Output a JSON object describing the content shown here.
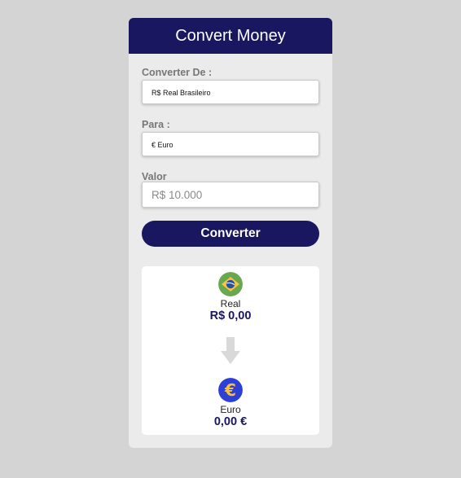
{
  "header": {
    "title": "Convert Money"
  },
  "form": {
    "from_label": "Converter De :",
    "from_selected": "R$ Real Brasileiro",
    "to_label": "Para :",
    "to_selected": "€ Euro",
    "value_label": "Valor",
    "value_placeholder": "R$ 10.000",
    "convert_label": "Converter"
  },
  "result": {
    "source": {
      "name": "Real",
      "amount": "R$ 0,00",
      "icon": "brazil-flag-icon"
    },
    "target": {
      "name": "Euro",
      "amount": "0,00 €",
      "icon": "euro-coin-icon"
    }
  },
  "colors": {
    "primary": "#191760",
    "background": "#d4d4d4",
    "card": "#ebebeb",
    "panel": "#ffffff",
    "label": "#777777"
  }
}
